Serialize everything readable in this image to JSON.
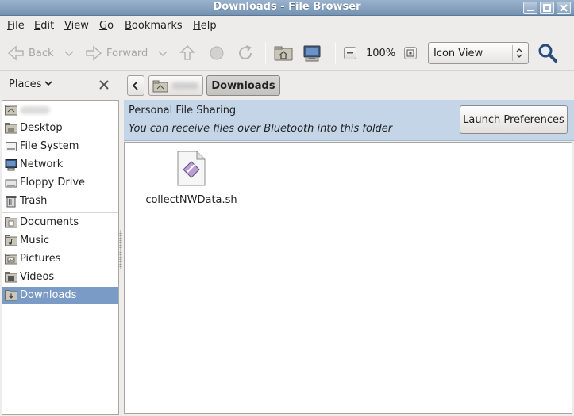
{
  "window": {
    "title": "Downloads - File Browser"
  },
  "menu": [
    {
      "label": "File",
      "accel": "F",
      "rest": "ile"
    },
    {
      "label": "Edit",
      "accel": "E",
      "rest": "dit"
    },
    {
      "label": "View",
      "accel": "V",
      "rest": "iew"
    },
    {
      "label": "Go",
      "accel": "G",
      "rest": "o"
    },
    {
      "label": "Bookmarks",
      "accel": "B",
      "rest": "ookmarks"
    },
    {
      "label": "Help",
      "accel": "H",
      "rest": "elp"
    }
  ],
  "toolbar": {
    "back_label": "Back",
    "forward_label": "Forward",
    "zoom_value": "100%",
    "view_mode": "Icon View"
  },
  "sidebar": {
    "header_label": "Places",
    "items": [
      {
        "label": "",
        "icon": "home-folder-icon"
      },
      {
        "label": "Desktop",
        "icon": "folder-icon"
      },
      {
        "label": "File System",
        "icon": "drive-icon"
      },
      {
        "label": "Network",
        "icon": "network-icon"
      },
      {
        "label": "Floppy Drive",
        "icon": "floppy-icon"
      },
      {
        "label": "Trash",
        "icon": "trash-icon"
      },
      {
        "label": "Documents",
        "icon": "folder-icon"
      },
      {
        "label": "Music",
        "icon": "folder-icon"
      },
      {
        "label": "Pictures",
        "icon": "folder-icon"
      },
      {
        "label": "Videos",
        "icon": "folder-icon"
      },
      {
        "label": "Downloads",
        "icon": "folder-icon",
        "selected": true
      }
    ]
  },
  "pathbar": {
    "current": "Downloads"
  },
  "infobar": {
    "title": "Personal File Sharing",
    "description": "You can receive files over Bluetooth into this folder",
    "button_label": "Launch Preferences"
  },
  "files": [
    {
      "name": "collectNWData.sh",
      "icon": "script-file-icon"
    }
  ],
  "colors": {
    "selection": "#7a9bc6",
    "infobar": "#c5d5e8",
    "titlebar": "#7592b3"
  }
}
